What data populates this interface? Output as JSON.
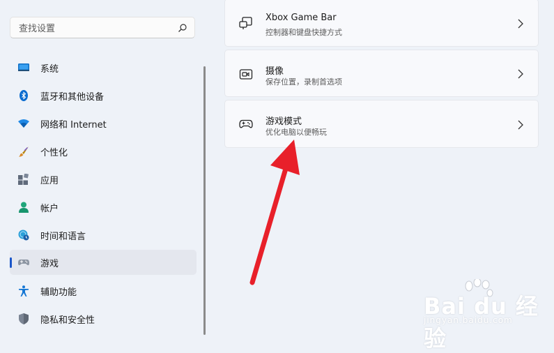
{
  "search": {
    "placeholder": "查找设置",
    "icon": "search-icon"
  },
  "sidebar": {
    "active_indicator_color": "#1a56c9",
    "items": [
      {
        "label": "系统",
        "icon": "system-monitor-icon",
        "active": false
      },
      {
        "label": "蓝牙和其他设备",
        "icon": "bluetooth-icon",
        "active": false
      },
      {
        "label": "网络和 Internet",
        "icon": "wifi-icon",
        "active": false
      },
      {
        "label": "个性化",
        "icon": "paintbrush-icon",
        "active": false
      },
      {
        "label": "应用",
        "icon": "apps-icon",
        "active": false
      },
      {
        "label": "帐户",
        "icon": "account-icon",
        "active": false
      },
      {
        "label": "时间和语言",
        "icon": "globe-clock-icon",
        "active": false
      },
      {
        "label": "游戏",
        "icon": "gamepad-icon",
        "active": true
      },
      {
        "label": "辅助功能",
        "icon": "accessibility-icon",
        "active": false
      },
      {
        "label": "隐私和安全性",
        "icon": "shield-icon",
        "active": false
      }
    ]
  },
  "main": {
    "cards": [
      {
        "title": "Xbox Game Bar",
        "subtitle": "控制器和键盘快捷方式",
        "icon": "game-bar-icon"
      },
      {
        "title": "摄像",
        "subtitle": "保存位置，录制首选项",
        "icon": "capture-icon"
      },
      {
        "title": "游戏模式",
        "subtitle": "优化电脑以便畅玩",
        "icon": "game-mode-icon"
      }
    ]
  },
  "annotation": {
    "arrow_color": "#e8202a"
  },
  "watermark": {
    "text": "Bai du 经验",
    "url": "jingyan.baidu.com"
  }
}
